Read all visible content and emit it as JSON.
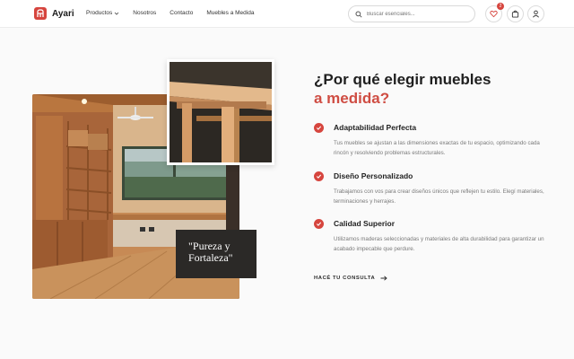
{
  "brand": {
    "name": "Ayari",
    "color": "#d6453e"
  },
  "nav": {
    "items": [
      "Productos",
      "Nosotros",
      "Contacto",
      "Muebles a Medida"
    ]
  },
  "search": {
    "placeholder": "Buscar esenciales..."
  },
  "header_icons": {
    "wishlist_count": "2",
    "icons": [
      "heart-icon",
      "bag-icon",
      "user-icon"
    ]
  },
  "hero": {
    "title_line1": "¿Por qué elegir muebles",
    "title_line2": "a medida?",
    "quote_line1": "\"Pureza y",
    "quote_line2": "Fortaleza\""
  },
  "features": [
    {
      "title": "Adaptabilidad Perfecta",
      "text": "Tus muebles se ajustan a las dimensiones exactas de tu espacio, optimizando cada rincón y resolviendo problemas estructurales."
    },
    {
      "title": "Diseño Personalizado",
      "text": "Trabajamos con vos para crear diseños únicos que reflejen tu estilo. Elegí materiales, terminaciones y herrajes."
    },
    {
      "title": "Calidad Superior",
      "text": "Utilizamos maderas seleccionadas y materiales de alta durabilidad para garantizar un acabado impecable que perdure."
    }
  ],
  "cta": {
    "label": "HACÉ TU CONSULTA"
  }
}
